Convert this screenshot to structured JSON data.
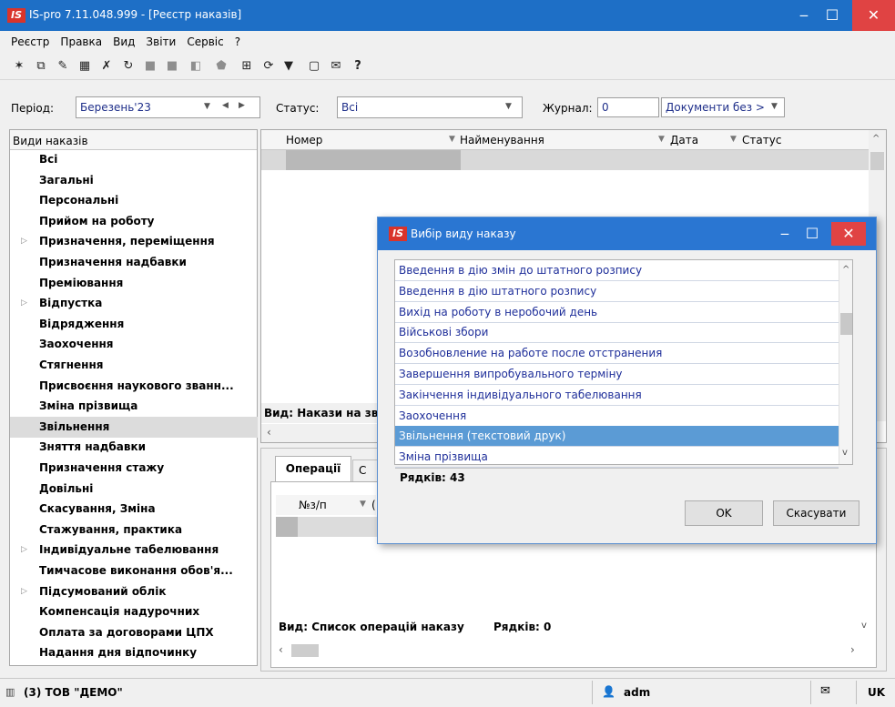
{
  "window": {
    "title": "IS-pro 7.11.048.999 - [Реєстр наказів]",
    "logo": "IS"
  },
  "menu": [
    "Реєстр",
    "Правка",
    "Вид",
    "Звіти",
    "Сервіс",
    "?"
  ],
  "filters": {
    "period_label": "Період:",
    "period_value": "Березень'23",
    "status_label": "Статус:",
    "status_value": "Всі",
    "journal_label": "Журнал:",
    "journal_value": "0",
    "journal_desc": "Документи без >"
  },
  "tree": {
    "header": "Види наказів",
    "items": [
      {
        "label": "Всі",
        "arrow": ""
      },
      {
        "label": "Загальні",
        "arrow": ""
      },
      {
        "label": "Персональні",
        "arrow": ""
      },
      {
        "label": "Прийом на роботу",
        "arrow": ""
      },
      {
        "label": "Призначення, переміщення",
        "arrow": "▷"
      },
      {
        "label": "Призначення надбавки",
        "arrow": ""
      },
      {
        "label": "Преміювання",
        "arrow": ""
      },
      {
        "label": "Відпустка",
        "arrow": "▷"
      },
      {
        "label": "Відрядження",
        "arrow": ""
      },
      {
        "label": "Заохочення",
        "arrow": ""
      },
      {
        "label": "Стягнення",
        "arrow": ""
      },
      {
        "label": "Присвоєння наукового званн...",
        "arrow": ""
      },
      {
        "label": "Зміна прізвища",
        "arrow": ""
      },
      {
        "label": "Звільнення",
        "arrow": ""
      },
      {
        "label": "Зняття надбавки",
        "arrow": ""
      },
      {
        "label": "Призначення стажу",
        "arrow": ""
      },
      {
        "label": "Довільні",
        "arrow": ""
      },
      {
        "label": "Скасування, Зміна",
        "arrow": ""
      },
      {
        "label": "Стажування, практика",
        "arrow": ""
      },
      {
        "label": "Індивідуальне табелювання",
        "arrow": "▷"
      },
      {
        "label": "Тимчасове виконання обов'я...",
        "arrow": ""
      },
      {
        "label": "Підсумований облік",
        "arrow": "▷"
      },
      {
        "label": "Компенсація надурочних",
        "arrow": ""
      },
      {
        "label": "Оплата за договорами ЦПХ",
        "arrow": ""
      },
      {
        "label": "Надання дня відпочинку",
        "arrow": ""
      }
    ]
  },
  "main_grid": {
    "columns": [
      "Номер",
      "Найменування",
      "Дата",
      "Статус"
    ],
    "footer": "Вид: Накази на зв"
  },
  "bottom": {
    "tab_operations": "Операції",
    "tab_other": "С",
    "col_num": "№з/п",
    "col_next": "(",
    "footer_view": "Вид: Список операцій наказу",
    "footer_rows": "Рядків: 0"
  },
  "dialog": {
    "title": "Вибір виду наказу",
    "items": [
      "Введення в дію змін до штатного розпису",
      "Введення в дію штатного розпису",
      "Вихід на роботу в неробочий день",
      "Військові збори",
      "Возобновление на работе после отстранения",
      "Завершення випробувального терміну",
      "Закінчення індивідуального табелювання",
      "Заохочення",
      "Звільнення (текстовий друк)",
      "Зміна прізвища"
    ],
    "selected_index": 8,
    "rows": "Рядків: 43",
    "ok": "OK",
    "cancel": "Скасувати"
  },
  "statusbar": {
    "company": "(3) ТОВ \"ДЕМО\"",
    "user": "adm",
    "lang": "UK"
  },
  "colors": {
    "titlebar": "#1e6fc6",
    "close": "#e04343",
    "selected": "#5b9bd5",
    "link_text": "#1f2f9a"
  }
}
